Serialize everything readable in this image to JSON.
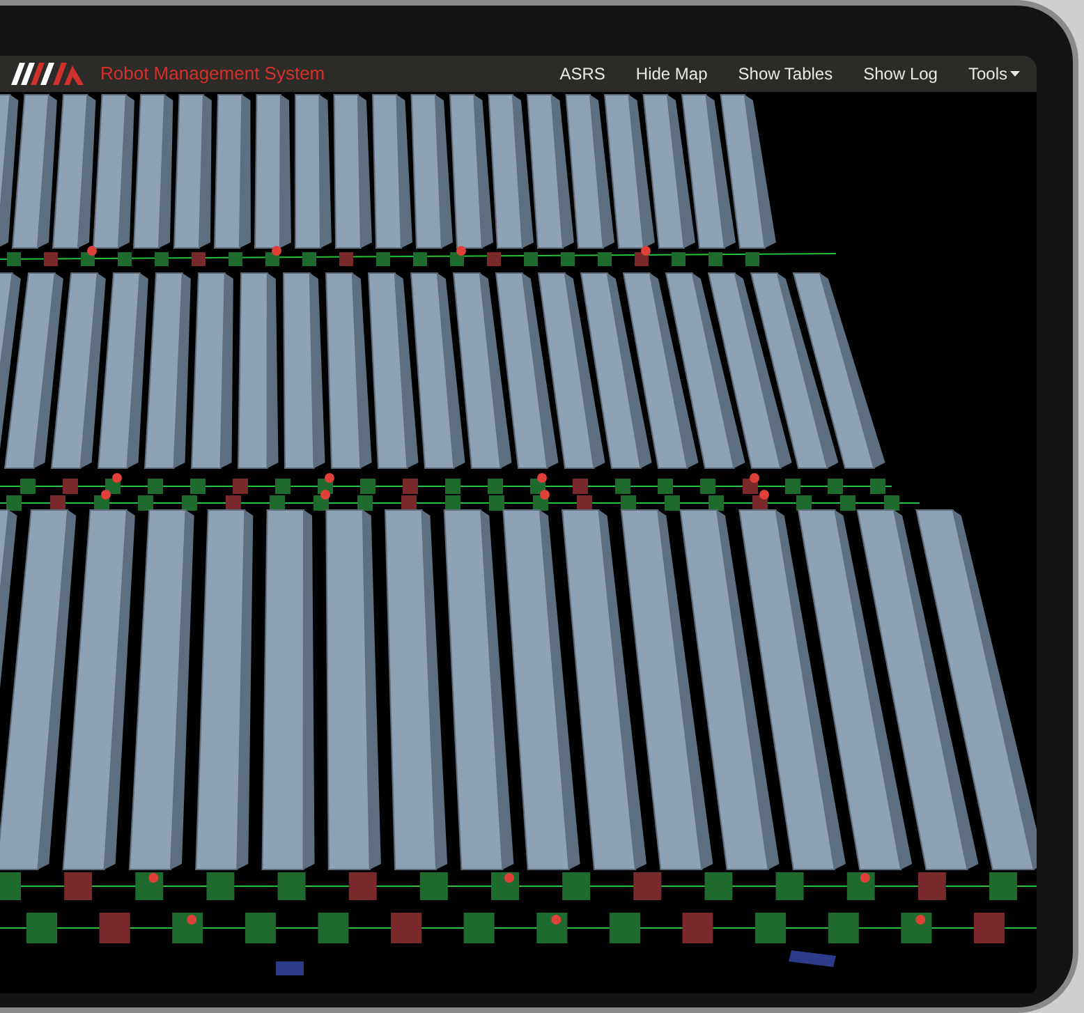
{
  "navbar": {
    "title": "Robot Management System",
    "menu": [
      {
        "label": "ASRS",
        "dropdown": false
      },
      {
        "label": "Hide Map",
        "dropdown": false
      },
      {
        "label": "Show Tables",
        "dropdown": false
      },
      {
        "label": "Show Log",
        "dropdown": false
      },
      {
        "label": "Tools",
        "dropdown": true
      }
    ]
  }
}
